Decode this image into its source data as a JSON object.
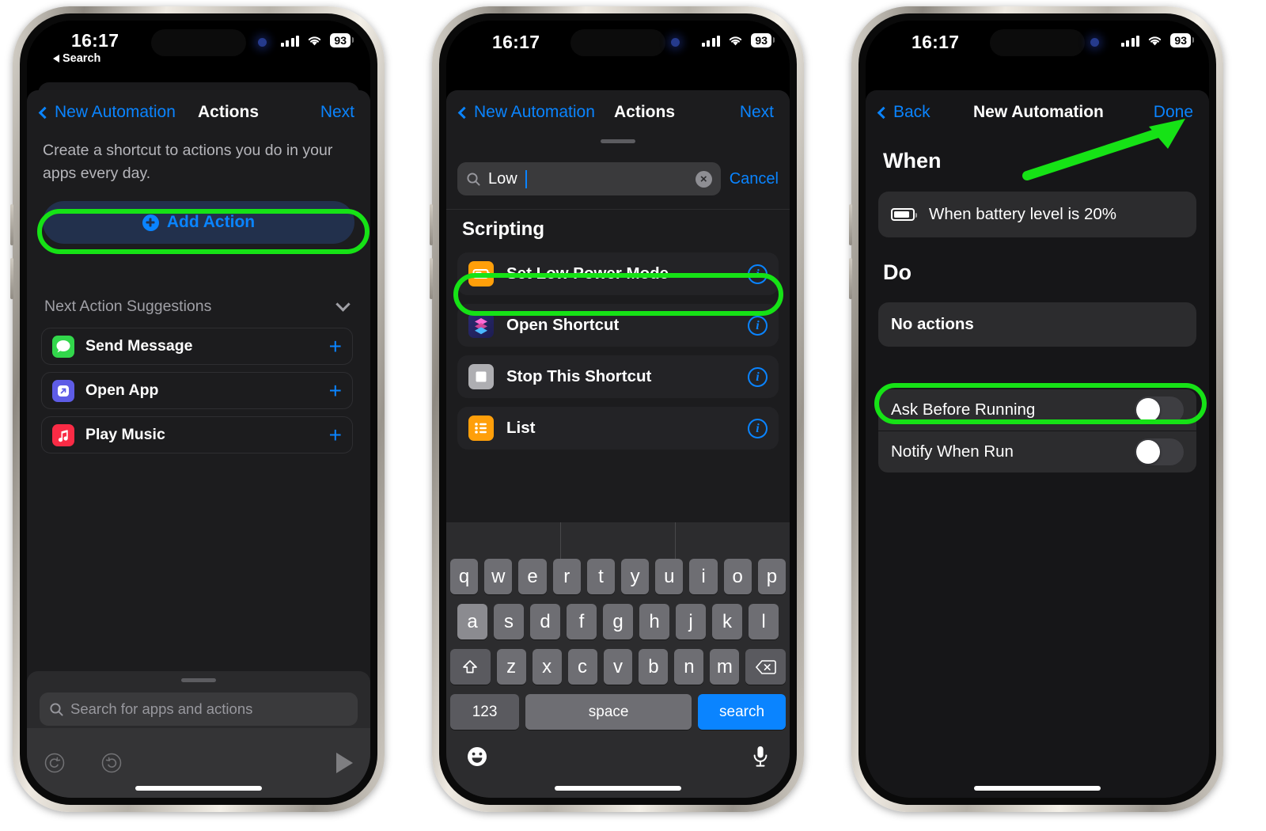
{
  "status_bar": {
    "time": "16:17",
    "back_label": "Search",
    "battery": "93",
    "wifi_icon": "wifi-icon",
    "cellular_icon": "cellular-bars-icon"
  },
  "phone1": {
    "nav": {
      "back": "New Automation",
      "title": "Actions",
      "right": "Next"
    },
    "description": "Create a shortcut to actions you do in your apps every day.",
    "add_action": {
      "label": "Add Action",
      "icon": "plus-circle-icon"
    },
    "suggestions_header": "Next Action Suggestions",
    "suggestions": [
      {
        "label": "Send Message",
        "icon": "messages-app-icon",
        "color": "#32d74b",
        "add": "+"
      },
      {
        "label": "Open App",
        "icon": "open-app-icon",
        "color": "#5e5ce6",
        "add": "+"
      },
      {
        "label": "Play Music",
        "icon": "music-app-icon",
        "color": "#fa2b45",
        "add": "+"
      }
    ],
    "search_placeholder": "Search for apps and actions",
    "toolbar": {
      "undo": "undo-icon",
      "redo": "redo-icon",
      "play": "play-icon"
    }
  },
  "phone2": {
    "nav": {
      "back": "New Automation",
      "title": "Actions",
      "right": "Next"
    },
    "search": {
      "value": "Low",
      "clear": "×",
      "cancel": "Cancel",
      "icon": "search-icon"
    },
    "section_header": "Scripting",
    "results": [
      {
        "label": "Set Low Power Mode",
        "icon": "low-power-mode-icon",
        "color": "#ff9f0a",
        "info": "i"
      },
      {
        "label": "Open Shortcut",
        "icon": "shortcuts-app-icon",
        "color": "#2a2a6e",
        "info": "i"
      },
      {
        "label": "Stop This Shortcut",
        "icon": "stop-icon",
        "color": "#aeaeb2",
        "info": "i"
      },
      {
        "label": "List",
        "icon": "list-icon",
        "color": "#ff9f0a",
        "info": "i"
      }
    ],
    "keyboard": {
      "row1": [
        "q",
        "w",
        "e",
        "r",
        "t",
        "y",
        "u",
        "i",
        "o",
        "p"
      ],
      "row2": [
        "a",
        "s",
        "d",
        "f",
        "g",
        "h",
        "j",
        "k",
        "l"
      ],
      "row3": [
        "z",
        "x",
        "c",
        "v",
        "b",
        "n",
        "m"
      ],
      "shift": "shift-icon",
      "backspace": "backspace-icon",
      "numbers": "123",
      "space": "space",
      "return": "search",
      "emoji": "emoji-icon",
      "dictation": "microphone-icon"
    }
  },
  "phone3": {
    "nav": {
      "back": "Back",
      "title": "New Automation",
      "right": "Done"
    },
    "when_header": "When",
    "trigger": {
      "label": "When battery level is 20%",
      "icon": "battery-icon"
    },
    "do_header": "Do",
    "no_actions": "No actions",
    "toggles": [
      {
        "label": "Ask Before Running",
        "state": "off"
      },
      {
        "label": "Notify When Run",
        "state": "off"
      }
    ]
  },
  "annotations": {
    "highlight_color": "#16e216",
    "arrow_target": "Done"
  }
}
